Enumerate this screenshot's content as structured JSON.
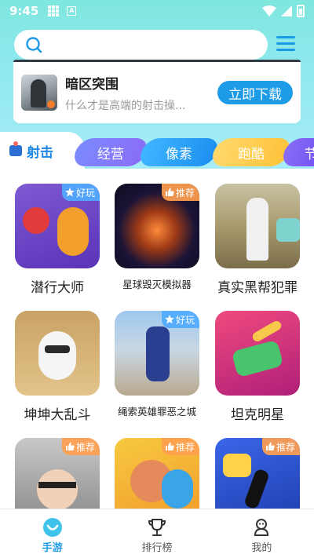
{
  "status_bar": {
    "time": "9:45",
    "badge": "A"
  },
  "search": {
    "placeholder": ""
  },
  "banner": {
    "title": "暗区突围",
    "subtitle": "什么才是高端的射击操...",
    "button_label": "立即下载"
  },
  "tabs": {
    "active": {
      "label": "射击"
    },
    "items": [
      {
        "label": "经营"
      },
      {
        "label": "像素"
      },
      {
        "label": "跑酷"
      },
      {
        "label": "节"
      }
    ]
  },
  "games": [
    {
      "name": "潜行大师",
      "badge": "好玩",
      "badge_type": "good"
    },
    {
      "name": "星球毁灭模拟器",
      "badge": "推荐",
      "badge_type": "rec"
    },
    {
      "name": "真实黑帮犯罪",
      "badge": "",
      "badge_type": "none"
    },
    {
      "name": "坤坤大乱斗",
      "badge": "",
      "badge_type": "none"
    },
    {
      "name": "绳索英雄罪恶之城",
      "badge": "好玩",
      "badge_type": "good"
    },
    {
      "name": "坦克明星",
      "badge": "",
      "badge_type": "none"
    },
    {
      "name": "",
      "badge": "推荐",
      "badge_type": "rec"
    },
    {
      "name": "",
      "badge": "推荐",
      "badge_type": "rec"
    },
    {
      "name": "",
      "badge": "推荐",
      "badge_type": "rec"
    }
  ],
  "bottom_nav": [
    {
      "label": "手游",
      "active": true
    },
    {
      "label": "排行榜",
      "active": false
    },
    {
      "label": "我的",
      "active": false
    }
  ],
  "colors": {
    "accent": "#1e9be6",
    "top_gradient": "#7fe7de"
  }
}
